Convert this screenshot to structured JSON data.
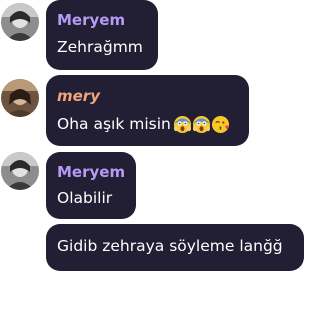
{
  "chat": {
    "messages": [
      {
        "sender": "Meryem",
        "text": "Zehrağmm"
      },
      {
        "sender": "mery",
        "text": "Oha aşık misin",
        "emojis": [
          "face-screaming-in-fear-emoji",
          "face-screaming-in-fear-emoji",
          "face-blowing-kiss-emoji"
        ]
      },
      {
        "sender": "Meryem",
        "text": "Olabilir"
      },
      {
        "text": "Gidib zehraya söyleme lanğğ"
      }
    ]
  },
  "colors": {
    "bubble": "#221e34",
    "name_meryem": "#b39cf2",
    "name_mery": "#f0a57c",
    "text": "#ffffff"
  }
}
